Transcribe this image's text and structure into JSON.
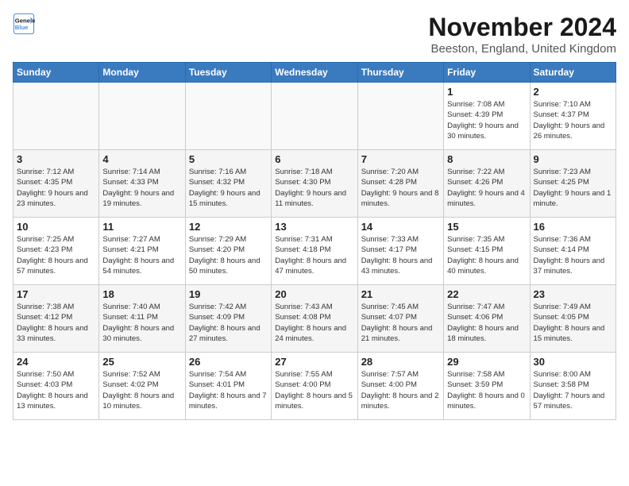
{
  "header": {
    "logo_line1": "General",
    "logo_line2": "Blue",
    "title": "November 2024",
    "subtitle": "Beeston, England, United Kingdom"
  },
  "weekdays": [
    "Sunday",
    "Monday",
    "Tuesday",
    "Wednesday",
    "Thursday",
    "Friday",
    "Saturday"
  ],
  "weeks": [
    [
      {
        "day": "",
        "info": ""
      },
      {
        "day": "",
        "info": ""
      },
      {
        "day": "",
        "info": ""
      },
      {
        "day": "",
        "info": ""
      },
      {
        "day": "",
        "info": ""
      },
      {
        "day": "1",
        "info": "Sunrise: 7:08 AM\nSunset: 4:39 PM\nDaylight: 9 hours\nand 30 minutes."
      },
      {
        "day": "2",
        "info": "Sunrise: 7:10 AM\nSunset: 4:37 PM\nDaylight: 9 hours\nand 26 minutes."
      }
    ],
    [
      {
        "day": "3",
        "info": "Sunrise: 7:12 AM\nSunset: 4:35 PM\nDaylight: 9 hours\nand 23 minutes."
      },
      {
        "day": "4",
        "info": "Sunrise: 7:14 AM\nSunset: 4:33 PM\nDaylight: 9 hours\nand 19 minutes."
      },
      {
        "day": "5",
        "info": "Sunrise: 7:16 AM\nSunset: 4:32 PM\nDaylight: 9 hours\nand 15 minutes."
      },
      {
        "day": "6",
        "info": "Sunrise: 7:18 AM\nSunset: 4:30 PM\nDaylight: 9 hours\nand 11 minutes."
      },
      {
        "day": "7",
        "info": "Sunrise: 7:20 AM\nSunset: 4:28 PM\nDaylight: 9 hours\nand 8 minutes."
      },
      {
        "day": "8",
        "info": "Sunrise: 7:22 AM\nSunset: 4:26 PM\nDaylight: 9 hours\nand 4 minutes."
      },
      {
        "day": "9",
        "info": "Sunrise: 7:23 AM\nSunset: 4:25 PM\nDaylight: 9 hours\nand 1 minute."
      }
    ],
    [
      {
        "day": "10",
        "info": "Sunrise: 7:25 AM\nSunset: 4:23 PM\nDaylight: 8 hours\nand 57 minutes."
      },
      {
        "day": "11",
        "info": "Sunrise: 7:27 AM\nSunset: 4:21 PM\nDaylight: 8 hours\nand 54 minutes."
      },
      {
        "day": "12",
        "info": "Sunrise: 7:29 AM\nSunset: 4:20 PM\nDaylight: 8 hours\nand 50 minutes."
      },
      {
        "day": "13",
        "info": "Sunrise: 7:31 AM\nSunset: 4:18 PM\nDaylight: 8 hours\nand 47 minutes."
      },
      {
        "day": "14",
        "info": "Sunrise: 7:33 AM\nSunset: 4:17 PM\nDaylight: 8 hours\nand 43 minutes."
      },
      {
        "day": "15",
        "info": "Sunrise: 7:35 AM\nSunset: 4:15 PM\nDaylight: 8 hours\nand 40 minutes."
      },
      {
        "day": "16",
        "info": "Sunrise: 7:36 AM\nSunset: 4:14 PM\nDaylight: 8 hours\nand 37 minutes."
      }
    ],
    [
      {
        "day": "17",
        "info": "Sunrise: 7:38 AM\nSunset: 4:12 PM\nDaylight: 8 hours\nand 33 minutes."
      },
      {
        "day": "18",
        "info": "Sunrise: 7:40 AM\nSunset: 4:11 PM\nDaylight: 8 hours\nand 30 minutes."
      },
      {
        "day": "19",
        "info": "Sunrise: 7:42 AM\nSunset: 4:09 PM\nDaylight: 8 hours\nand 27 minutes."
      },
      {
        "day": "20",
        "info": "Sunrise: 7:43 AM\nSunset: 4:08 PM\nDaylight: 8 hours\nand 24 minutes."
      },
      {
        "day": "21",
        "info": "Sunrise: 7:45 AM\nSunset: 4:07 PM\nDaylight: 8 hours\nand 21 minutes."
      },
      {
        "day": "22",
        "info": "Sunrise: 7:47 AM\nSunset: 4:06 PM\nDaylight: 8 hours\nand 18 minutes."
      },
      {
        "day": "23",
        "info": "Sunrise: 7:49 AM\nSunset: 4:05 PM\nDaylight: 8 hours\nand 15 minutes."
      }
    ],
    [
      {
        "day": "24",
        "info": "Sunrise: 7:50 AM\nSunset: 4:03 PM\nDaylight: 8 hours\nand 13 minutes."
      },
      {
        "day": "25",
        "info": "Sunrise: 7:52 AM\nSunset: 4:02 PM\nDaylight: 8 hours\nand 10 minutes."
      },
      {
        "day": "26",
        "info": "Sunrise: 7:54 AM\nSunset: 4:01 PM\nDaylight: 8 hours\nand 7 minutes."
      },
      {
        "day": "27",
        "info": "Sunrise: 7:55 AM\nSunset: 4:00 PM\nDaylight: 8 hours\nand 5 minutes."
      },
      {
        "day": "28",
        "info": "Sunrise: 7:57 AM\nSunset: 4:00 PM\nDaylight: 8 hours\nand 2 minutes."
      },
      {
        "day": "29",
        "info": "Sunrise: 7:58 AM\nSunset: 3:59 PM\nDaylight: 8 hours\nand 0 minutes."
      },
      {
        "day": "30",
        "info": "Sunrise: 8:00 AM\nSunset: 3:58 PM\nDaylight: 7 hours\nand 57 minutes."
      }
    ]
  ]
}
